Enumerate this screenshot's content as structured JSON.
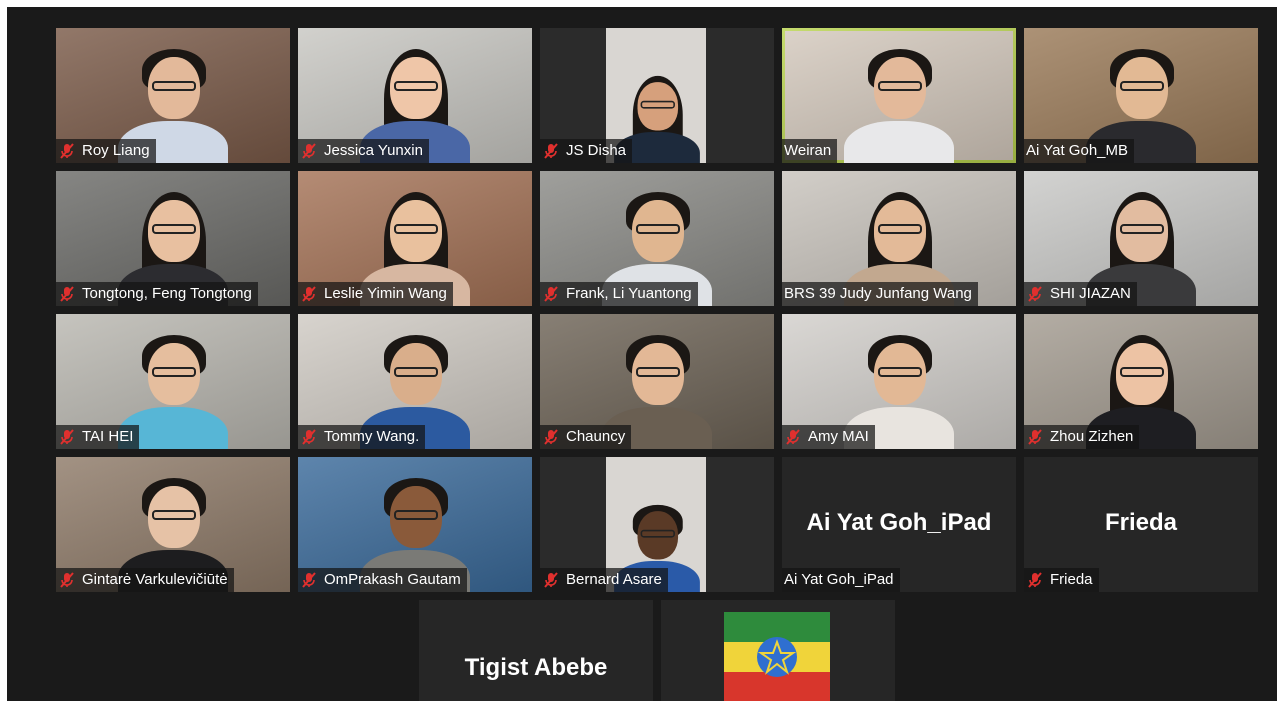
{
  "participants": [
    {
      "name": "Roy Liang",
      "muted": true,
      "bg": "#7a5a48",
      "shirt": "#cfd8e6",
      "skin": "#e3b99a",
      "hair": "short"
    },
    {
      "name": "Jessica Yunxin",
      "muted": true,
      "bg": "#c8c7c2",
      "shirt": "#4a67a6",
      "skin": "#efc6a8",
      "hair": "long"
    },
    {
      "name": "JS Disha",
      "muted": true,
      "bg": "#2b2b2b",
      "shirt": "#1d2a3c",
      "skin": "#d6a07c",
      "hair": "long"
    },
    {
      "name": "Weiran",
      "muted": false,
      "active": true,
      "bg": "#d4c9bd",
      "shirt": "#e8e8ea",
      "skin": "#e3b99a",
      "hair": "short"
    },
    {
      "name": "Ai Yat Goh_MB",
      "muted": false,
      "bg": "#9a7a58",
      "shirt": "#2a2a2e",
      "skin": "#e2b994",
      "hair": "short"
    },
    {
      "name": "Tongtong, Feng Tongtong",
      "muted": true,
      "bg": "#6b6b68",
      "shirt": "#2c2c30",
      "skin": "#e8c0a0",
      "hair": "long"
    },
    {
      "name": "Leslie Yimin Wang",
      "muted": true,
      "bg": "#a47256",
      "shirt": "#d7b7a1",
      "skin": "#e9c19e",
      "hair": "long"
    },
    {
      "name": "Frank, Li Yuantong",
      "muted": true,
      "bg": "#8a8a86",
      "shirt": "#dfe2e6",
      "skin": "#e0b690",
      "hair": "short"
    },
    {
      "name": "BRS 39 Judy Junfang Wang",
      "muted": false,
      "bg": "#c8c3bc",
      "shirt": "#c2a88f",
      "skin": "#e3ba98",
      "hair": "long"
    },
    {
      "name": "SHI JIAZAN",
      "muted": true,
      "bg": "#c9c9c7",
      "shirt": "#3a3a3c",
      "skin": "#e2bca0",
      "hair": "long"
    },
    {
      "name": "TAI HEI",
      "muted": true,
      "bg": "#b9b7b0",
      "shirt": "#57b6d6",
      "skin": "#e5be9e",
      "hair": "short"
    },
    {
      "name": "Tommy Wang.",
      "muted": true,
      "bg": "#cfcac3",
      "shirt": "#2c5aa0",
      "skin": "#d9ae8b",
      "hair": "short"
    },
    {
      "name": "Chauncy",
      "muted": true,
      "bg": "#6d6356",
      "shirt": "#6a5f52",
      "skin": "#e3b896",
      "hair": "short"
    },
    {
      "name": "Amy MAI",
      "muted": true,
      "bg": "#d2cfcb",
      "shirt": "#e8e4df",
      "skin": "#e2b895",
      "hair": "short"
    },
    {
      "name": "Zhou Zizhen",
      "muted": true,
      "bg": "#a39b90",
      "shirt": "#1e1e22",
      "skin": "#edc3a4",
      "hair": "long"
    },
    {
      "name": "Gintarė Varkulevičiūtė",
      "muted": true,
      "bg": "#8e7a68",
      "shirt": "#1d1d1f",
      "skin": "#e6c2a6",
      "hair": "short"
    },
    {
      "name": "OmPrakash Gautam",
      "muted": true,
      "bg": "#3a6a9a",
      "shirt": "#7a7a76",
      "skin": "#8a5a3a",
      "hair": "short"
    },
    {
      "name": "Bernard Asare",
      "muted": true,
      "bg": "#2b2b2b",
      "shirt": "#2a5aa8",
      "skin": "#5a3a26",
      "hair": "short"
    }
  ],
  "text_tiles": [
    {
      "display": "Ai Yat Goh_iPad",
      "label": "Ai Yat Goh_iPad",
      "muted": false
    },
    {
      "display": "Frieda",
      "label": "Frieda",
      "muted": true
    }
  ],
  "bottom_row": {
    "tile1_display": "Tigist Abebe"
  },
  "colors": {
    "active_border": "#b8d34e",
    "mic_muted": "#e0302e",
    "tile_bg": "#262626",
    "frame_bg": "#1a1a1a"
  }
}
